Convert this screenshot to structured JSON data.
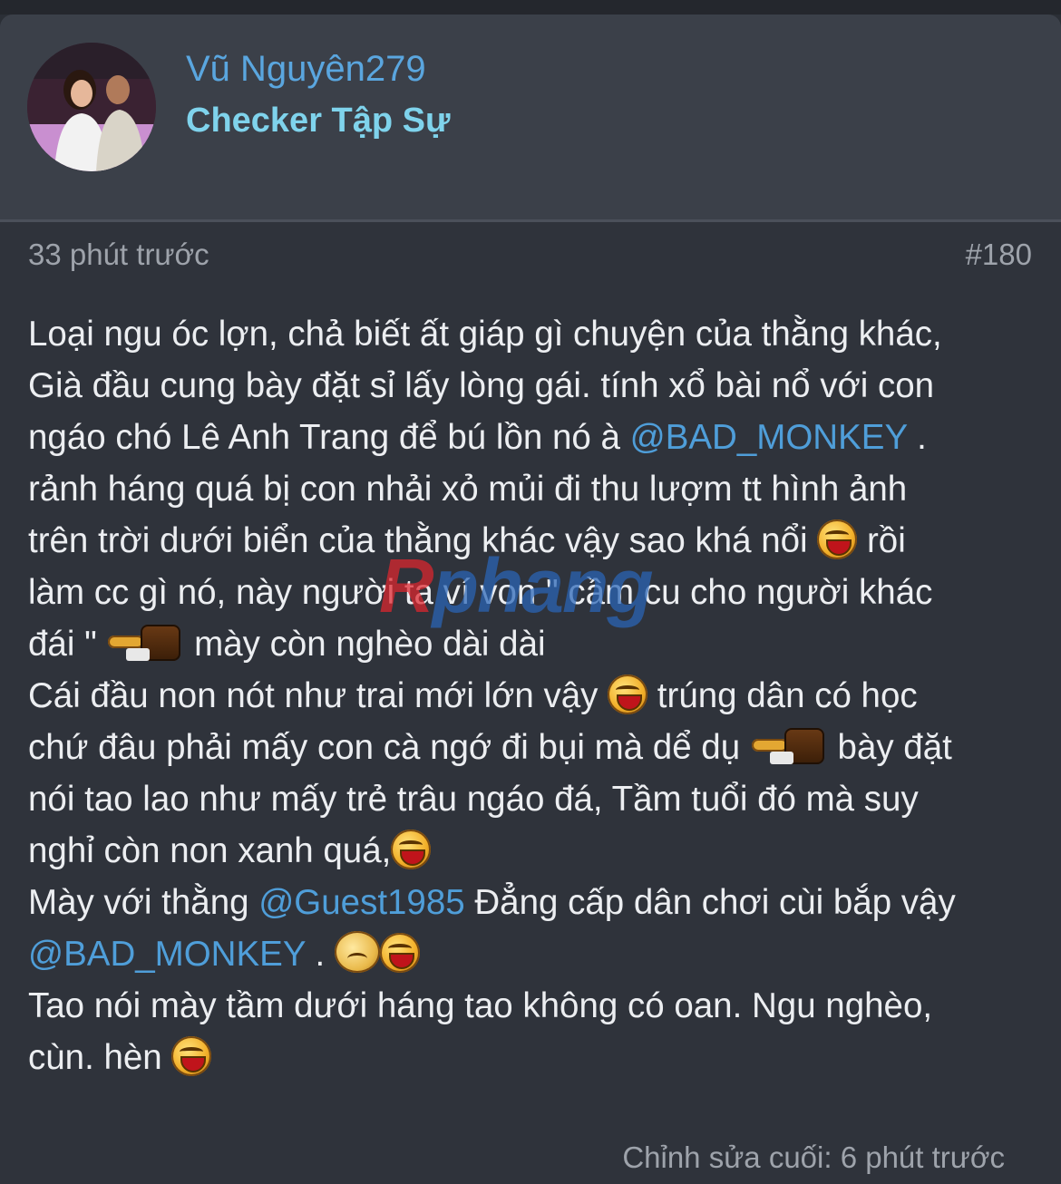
{
  "post": {
    "author": {
      "name": "Vũ Nguyên279",
      "title": "Checker Tập Sự"
    },
    "time": "33 phút trước",
    "number": "#180",
    "watermark": "Rphang",
    "edited": "Chỉnh sửa cuối: 6 phút trước",
    "lines": {
      "l1": "Loại ngu óc lợn, chả biết ất giáp gì chuyện của thằng khác,",
      "l2": "Già đầu cung bày đặt sỉ lấy lòng gái. tính xổ bài nổ với con",
      "l3a": "ngáo chó Lê Anh Trang để bú lồn nó à ",
      "l3m": "@BAD_MONKEY",
      "l3b": " .",
      "l4": "rảnh háng quá bị con nhải xỏ mủi đi thu lượm tt hình ảnh",
      "l5a": "trên trời dưới biển của thằng khác vậy sao khá nổi ",
      "l5b": " rồi",
      "l6": "làm cc gì nó, này người ta ví von \" cầm cu cho người khác",
      "l7a": "đái \" ",
      "l7b": " mày còn nghèo dài dài",
      "l8a": "Cái đầu non nót như trai mới lớn vậy ",
      "l8b": " trúng dân có học",
      "l9a": "chứ đâu phải mấy con cà ngớ đi bụi mà dể dụ ",
      "l9b": " bày đặt",
      "l10": "nói tao lao như mấy trẻ trâu ngáo đá, Tầm tuổi đó mà suy",
      "l11": "nghỉ còn non xanh quá,",
      "l12a": "Mày với thằng ",
      "l12m": "@Guest1985",
      "l12b": " Đẳng cấp dân chơi cùi bắp vậy",
      "l13m": "@BAD_MONKEY",
      "l13b": " . ",
      "l14": "Tao nói mày tầm dưới háng tao không có oan. Ngu nghèo,",
      "l15": "cùn. hèn "
    }
  },
  "colors": {
    "mention": "#4f9ed9",
    "username": "#5aa6df",
    "usertitle": "#7fd3ec"
  }
}
